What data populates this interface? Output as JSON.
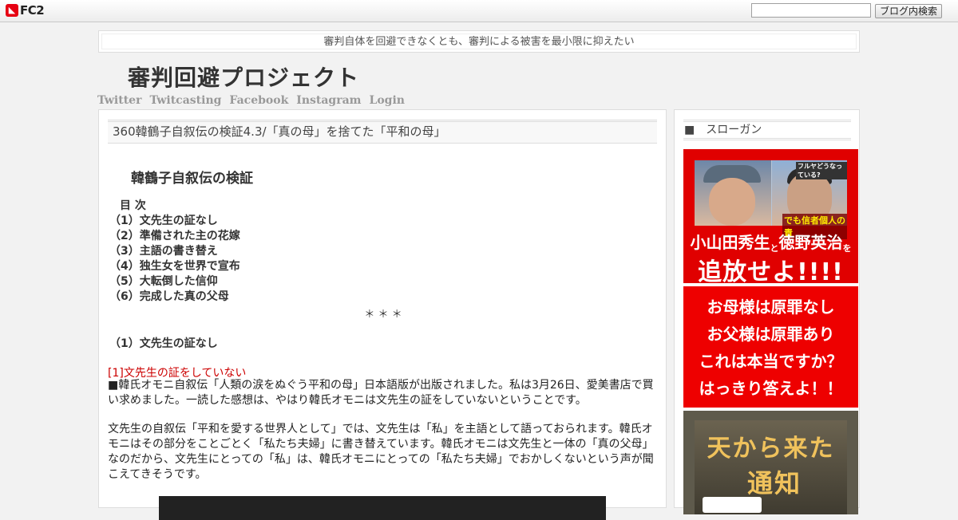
{
  "topbar": {
    "logo_text": "FC2",
    "search_placeholder": "",
    "search_button": "ブログ内検索"
  },
  "blog": {
    "description": "審判自体を回避できなくとも、審判による被害を最小限に抑えたい",
    "title": "審判回避プロジェクト",
    "nav": [
      "Twitter",
      "Twitcasting",
      "Facebook",
      "Instagram",
      "Login"
    ]
  },
  "entry": {
    "title": "360韓鶴子自叙伝の検証4.3/「真の母」を捨てた「平和の母」",
    "section_heading": "韓鶴子自叙伝の検証",
    "toc_head": "目 次",
    "toc": [
      "（1）文先生の証なし",
      "（2）準備された主の花嫁",
      "（3）主語の書き替え",
      "（4）独生女を世界で宣布",
      "（5）大転倒した信仰",
      "（6）完成した真の父母"
    ],
    "stars": "＊ ＊ ＊",
    "sub_heading": "（1）文先生の証なし",
    "red_heading": "[1]文先生の証をしていない",
    "paragraph1": "■韓氏オモニ自叙伝「人類の涙をぬぐう平和の母」日本語版が出版されました。私は3月26日、愛美書店で買い求めました。一読した感想は、やはり韓氏オモニは文先生の証をしていないということです。",
    "paragraph2": "文先生の自叙伝「平和を愛する世界人として」では、文先生は「私」を主語として語っておられます。韓氏オモニはその部分をことごとく「私たち夫婦」に書き替えています。韓氏オモニは文先生と一体の「真の父母」なのだから、文先生にとっての「私」は、韓氏オモニにとっての「私たち夫婦」でおかしくないという声が聞こえてきそうです。"
  },
  "sidebar": {
    "title_mark": "■",
    "title": "スローガン",
    "banner1": {
      "photo_top": "フルヤどうなっている?",
      "photo_caption": "でも信者個人の責",
      "line1_a": "小山田秀生",
      "line1_and": "と",
      "line1_b": "徳野英治",
      "line1_wo": "を",
      "line2": "追放せよ!!!!"
    },
    "banner2": [
      "お母様は原罪なし",
      "お父様は原罪あり",
      "これは本当ですか？",
      "はっきり答えよ！！"
    ],
    "banner3": {
      "line1": "天から来た",
      "line2": "通知"
    }
  },
  "colors": {
    "accent_red": "#e00000",
    "heading_red": "#cc0000",
    "nav_gray": "#999999"
  }
}
